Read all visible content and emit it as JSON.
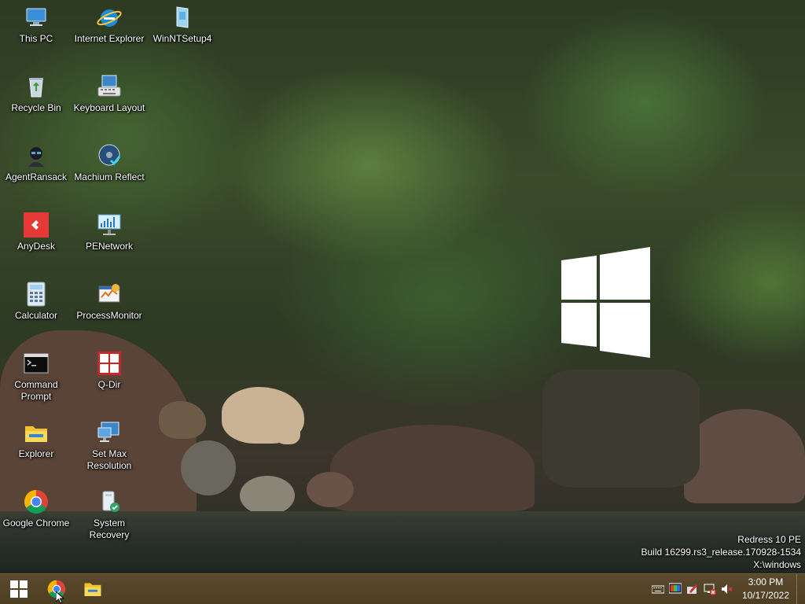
{
  "desktop": {
    "icons": [
      {
        "label": "This PC"
      },
      {
        "label": "Internet Explorer"
      },
      {
        "label": "WinNTSetup4"
      },
      {
        "label": "Recycle Bin"
      },
      {
        "label": "Keyboard Layout"
      },
      {
        "label": "AgentRansack"
      },
      {
        "label": "Machium Reflect"
      },
      {
        "label": "AnyDesk"
      },
      {
        "label": "PENetwork"
      },
      {
        "label": "Calculator"
      },
      {
        "label": "ProcessMonitor"
      },
      {
        "label": "Command Prompt"
      },
      {
        "label": "Q-Dir"
      },
      {
        "label": "Explorer"
      },
      {
        "label": "Set Max Resolution"
      },
      {
        "label": "Google Chrome"
      },
      {
        "label": "System Recovery"
      }
    ]
  },
  "overlay": {
    "line1": "Redress 10 PE",
    "line2": "Build 16299.rs3_release.170928-1534",
    "line3": "X:\\windows"
  },
  "taskbar": {
    "start_icon": "windows-logo-icon",
    "pinned": [
      "chrome-icon",
      "file-explorer-icon"
    ],
    "tray_icons": [
      "keyboard-icon",
      "display-icon",
      "tool-icon",
      "network-disconnected-icon",
      "volume-muted-icon"
    ],
    "clock": {
      "time": "3:00 PM",
      "date": "10/17/2022"
    }
  },
  "colors": {
    "taskbar": "#4d3e23",
    "text": "#ffffff"
  }
}
